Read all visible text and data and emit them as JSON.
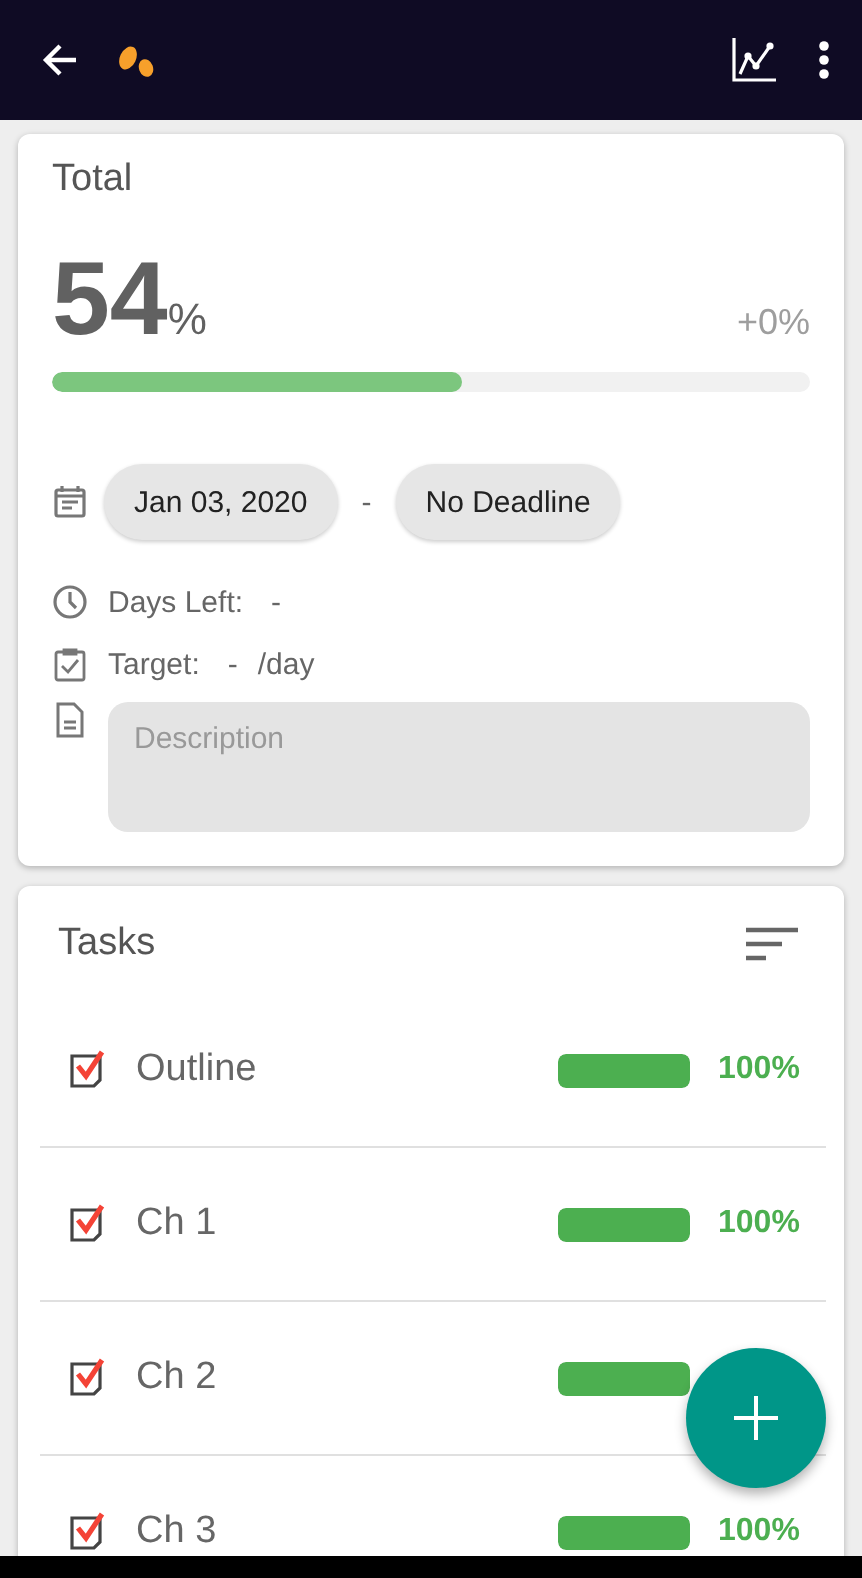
{
  "total": {
    "title": "Total",
    "percent": "54",
    "percent_sign": "%",
    "change": "+0%",
    "level": 0.54,
    "start_date": "Jan 03, 2020",
    "date_separator": "-",
    "end_date": "No Deadline",
    "days_left_label": "Days Left:",
    "days_left_value": "-",
    "target_label": "Target:",
    "target_value": "-",
    "target_unit": "/day",
    "description": {
      "placeholder": "Description"
    }
  },
  "tasks": {
    "title": "Tasks",
    "items": [
      {
        "name": "Outline",
        "checked": true,
        "level": 1,
        "percent": "100%"
      },
      {
        "name": "Ch 1",
        "checked": true,
        "level": 1,
        "percent": "100%"
      },
      {
        "name": "Ch 2",
        "checked": true,
        "level": 1
      },
      {
        "name": "Ch 3",
        "checked": true,
        "level": 1,
        "percent": "100%"
      }
    ]
  }
}
